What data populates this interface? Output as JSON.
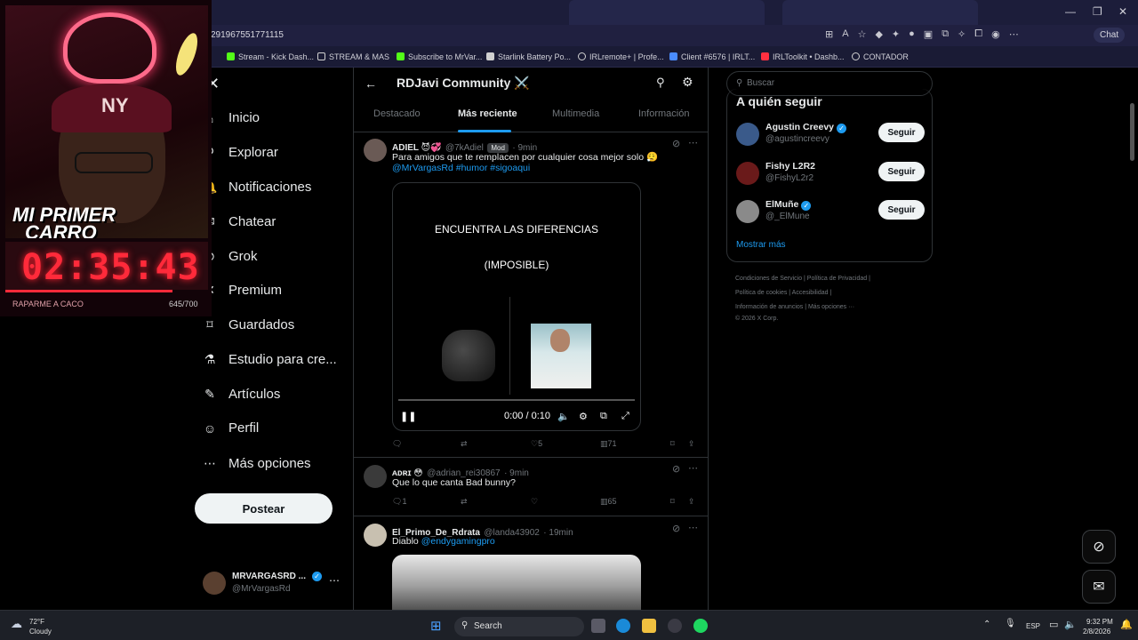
{
  "browser": {
    "url": "291967551771115",
    "copilot_label": "Chat",
    "window_controls": [
      "—",
      "❐",
      "✕"
    ],
    "bookmarks": [
      {
        "label": "Stream - Kick Dash...",
        "color": "#53fc18"
      },
      {
        "label": "STREAM & MAS",
        "color": "#d0d0d0"
      },
      {
        "label": "Subscribe to MrVar...",
        "color": "#53fc18"
      },
      {
        "label": "Starlink Battery Po...",
        "color": "#d0d0d0"
      },
      {
        "label": "IRLremote+ | Profe...",
        "color": "#d0d0d0"
      },
      {
        "label": "Client #6576 | IRLT...",
        "color": "#4a8cff"
      },
      {
        "label": "IRLToolkit • Dashb...",
        "color": "#ff3040"
      },
      {
        "label": "CONTADOR",
        "color": "#d0d0d0"
      }
    ]
  },
  "overlay": {
    "title_line1": "MI PRIMER",
    "title_line2": "CARRO",
    "cap_logo": "NY",
    "timer": "02:35:43",
    "caption": "RAPARME A CACO",
    "count": "645/700"
  },
  "sidebar": {
    "items": [
      {
        "label": "Inicio",
        "icon": "home-icon",
        "glyph": "⌂"
      },
      {
        "label": "Explorar",
        "icon": "search-icon",
        "glyph": "⚲"
      },
      {
        "label": "Notificaciones",
        "icon": "bell-icon",
        "glyph": "🔔"
      },
      {
        "label": "Chatear",
        "icon": "mail-icon",
        "glyph": "✉"
      },
      {
        "label": "Grok",
        "icon": "grok-icon",
        "glyph": "⊘"
      },
      {
        "label": "Premium",
        "icon": "x-icon",
        "glyph": "✕"
      },
      {
        "label": "Guardados",
        "icon": "bookmark-icon",
        "glyph": "⌑"
      },
      {
        "label": "Estudio para cre...",
        "icon": "studio-icon",
        "glyph": "⚗"
      },
      {
        "label": "Artículos",
        "icon": "article-icon",
        "glyph": "✎"
      },
      {
        "label": "Perfil",
        "icon": "person-icon",
        "glyph": "☺"
      },
      {
        "label": "Más opciones",
        "icon": "more-circle-icon",
        "glyph": "⋯"
      }
    ],
    "post_button": "Postear",
    "profile": {
      "name": "MRVARGASRD ...",
      "handle": "@MrVargasRd"
    }
  },
  "main": {
    "community_title": "RDJavi Community ⚔️",
    "tabs": [
      "Destacado",
      "Más reciente",
      "Multimedia",
      "Información"
    ],
    "posts": [
      {
        "name": "ADIEL 😈💞",
        "handle": "@7kAdiel",
        "badge": "Mod",
        "time": "· 9min",
        "text": "Para amigos que te remplacen por cualquier cosa mejor solo 😮‍💨",
        "links": "@MrVargasRd #humor #sigoaqui",
        "video": {
          "line1": "ENCUENTRA LAS DIFERENCIAS",
          "line2": "(IMPOSIBLE)",
          "time": "0:00 / 0:10",
          "progress": 0.0
        },
        "stats": {
          "replies": "",
          "reposts": "",
          "likes": "5",
          "views": "71"
        }
      },
      {
        "name": "ᴀᴅʀɪ 😳",
        "handle": "@adrian_rei30867",
        "time": "· 9min",
        "text": "Que lo que canta Bad bunny?",
        "stats": {
          "replies": "1",
          "reposts": "",
          "likes": "",
          "views": "65"
        }
      },
      {
        "name": "El_Primo_De_Rdrata",
        "handle": "@landa43902",
        "time": "· 19min",
        "text": "Diablo",
        "links": "@endygamingpro"
      }
    ]
  },
  "right": {
    "search_placeholder": "Buscar",
    "follow_title": "A quién seguir",
    "suggestions": [
      {
        "name": "Agustin Creevy",
        "handle": "@agustincreevy",
        "verified": true
      },
      {
        "name": "Fishy L2R2",
        "handle": "@FishyL2r2",
        "verified": false
      },
      {
        "name": "ElMuñe",
        "handle": "@_ElMune",
        "verified": true
      }
    ],
    "follow_button": "Seguir",
    "show_more": "Mostrar más",
    "footer": [
      "Condiciones de Servicio  |  Política de Privacidad  |",
      "Política de cookies  |  Accesibilidad  |",
      "Información de anuncios  |  Más opciones ···",
      "© 2026 X Corp."
    ]
  },
  "taskbar": {
    "weather_temp": "72°F",
    "weather_desc": "Cloudy",
    "search_label": "Search",
    "lang": "ESP",
    "time": "9:32 PM",
    "date": "2/8/2026"
  },
  "colors": {
    "accent": "#1d9bf0",
    "timer": "#ff2a3a",
    "background": "#000000"
  }
}
